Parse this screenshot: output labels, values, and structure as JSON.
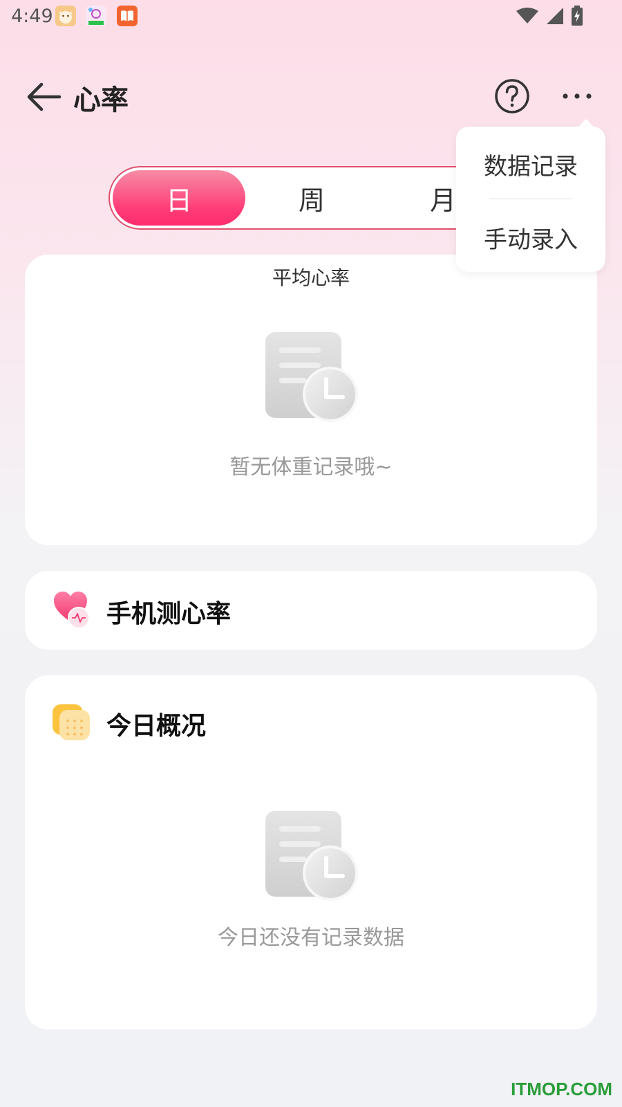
{
  "status_bar": {
    "time": "4:49",
    "apps": [
      "cat-app-icon",
      "flower-app-icon",
      "book-app-icon"
    ],
    "indicators": [
      "wifi-icon",
      "cellular-icon",
      "battery-charging-icon"
    ]
  },
  "header": {
    "title": "心率",
    "back_icon": "arrow-left-icon",
    "help_icon": "question-circle-icon",
    "more_icon": "more-dots-icon"
  },
  "tabs": [
    {
      "label": "日",
      "active": true
    },
    {
      "label": "周",
      "active": false
    },
    {
      "label": "月",
      "active": false
    }
  ],
  "menu": {
    "items": [
      "数据记录",
      "手动录入"
    ]
  },
  "avg_card": {
    "label": "平均心率",
    "empty_text": "暂无体重记录哦~"
  },
  "phone_card": {
    "title": "手机测心率",
    "icon": "heart-pulse-icon"
  },
  "today_card": {
    "title": "今日概况",
    "icon": "calendar-icon",
    "empty_text": "今日还没有记录数据"
  },
  "watermark": "ITMOP.COM",
  "colors": {
    "accent": "#ff2c6d",
    "tab_border": "#e0506f",
    "watermark": "#2a9d3a"
  }
}
